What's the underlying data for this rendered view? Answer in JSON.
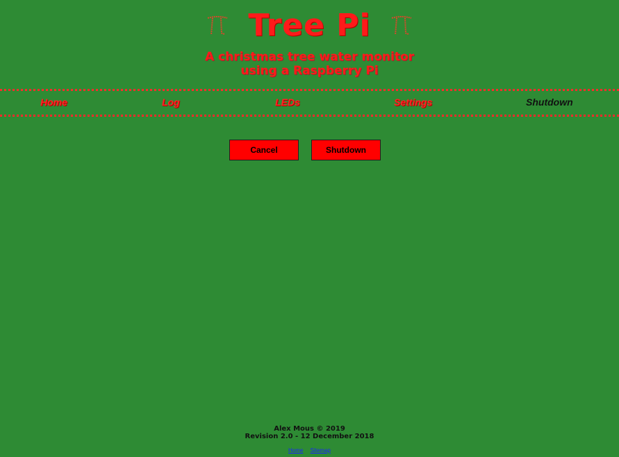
{
  "header": {
    "title": "Tree Pi",
    "subtitle_line1": "A christmas tree water monitor",
    "subtitle_line2": "using a Raspberry Pi",
    "left_icon": "pi-icon",
    "right_icon": "pi-icon"
  },
  "nav": {
    "items": [
      {
        "label": "Home"
      },
      {
        "label": "Log"
      },
      {
        "label": "LEDs"
      },
      {
        "label": "Settings"
      },
      {
        "label": "Shutdown"
      }
    ]
  },
  "actions": {
    "cancel_label": "Cancel",
    "shutdown_label": "Shutdown"
  },
  "footer": {
    "author": "Alex Mous © 2019",
    "revision": "Revision 2.0 - 12 December 2018",
    "links": [
      {
        "label": "Home"
      },
      {
        "label": "Sitemap"
      }
    ]
  },
  "theme": {
    "background": "#2e8b34",
    "accent_red": "#ff1a1a",
    "text_dark": "#111111",
    "button_red": "#ff0000",
    "link_blue": "#1a23ff"
  }
}
